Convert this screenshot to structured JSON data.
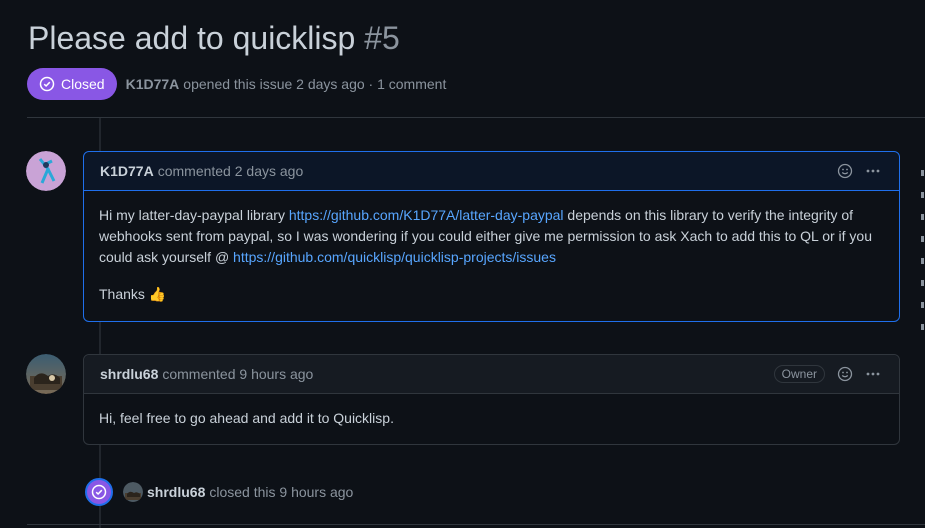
{
  "issue": {
    "title": "Please add to quicklisp",
    "number": "#5",
    "status": "Closed",
    "author": "K1D77A",
    "opened_text": "opened this issue 2 days ago · 1 comment"
  },
  "comments": [
    {
      "user": "K1D77A",
      "action": "commented 2 days ago",
      "body_1_pre": "Hi my latter-day-paypal library ",
      "body_1_link": "https://github.com/K1D77A/latter-day-paypal",
      "body_1_mid": " depends on this library to verify the integrity of webhooks sent from paypal, so I was wondering if you could either give me permission to ask Xach to add this to QL or if you could ask yourself @ ",
      "body_1_link2": "https://github.com/quicklisp/quicklisp-projects/issues",
      "body_2": "Thanks 👍"
    },
    {
      "user": "shrdlu68",
      "action": "commented 9 hours ago",
      "role": "Owner",
      "body_1": "Hi, feel free to go ahead and add it to Quicklisp."
    }
  ],
  "closed_event": {
    "user": "shrdlu68",
    "text": "closed this 9 hours ago"
  },
  "colors": {
    "closed_purple": "#8957e5",
    "link_blue": "#58a6ff",
    "background": "#0d1117"
  }
}
